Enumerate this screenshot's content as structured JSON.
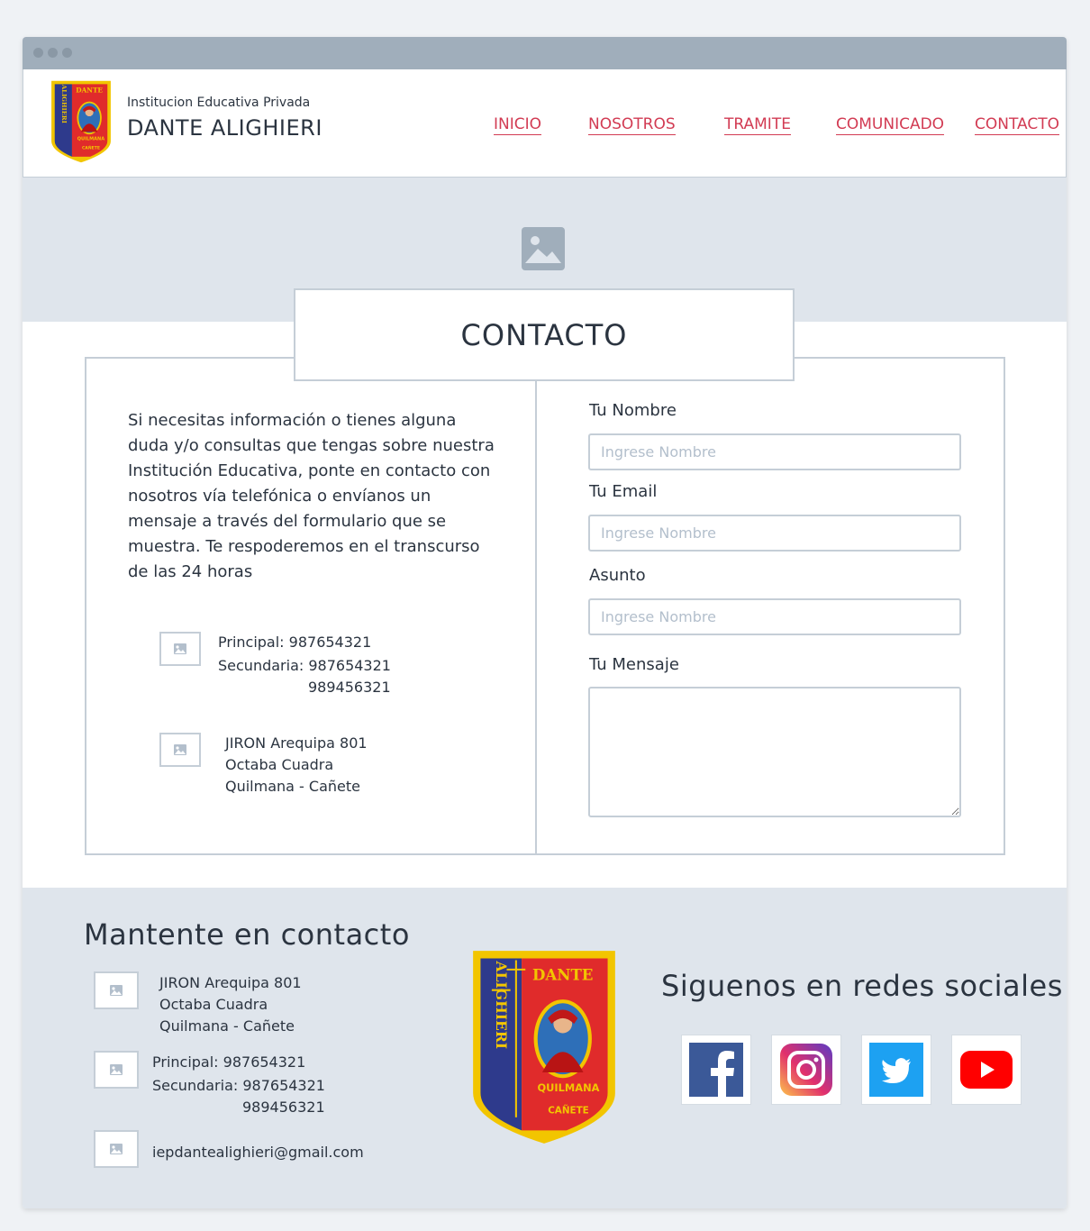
{
  "header": {
    "subtitle": "Institucion Educativa Privada",
    "title": "DANTE ALIGHIERI",
    "logo_text": {
      "top": "DANTE",
      "side": "ALIGHIERI",
      "bottom": "QUILMANA",
      "foot": "CAÑETE"
    }
  },
  "nav": {
    "items": [
      "INICIO",
      "NOSOTROS",
      "TRAMITE",
      "COMUNICADO",
      "CONTACTO"
    ]
  },
  "hero": {
    "image_icon": "image-placeholder-icon"
  },
  "contact": {
    "title": "CONTACTO",
    "intro": "Si necesitas información o tienes alguna duda y/o consultas que tengas sobre nuestra Institución Educativa, ponte en contacto con nosotros vía telefónica o envíanos un mensaje a través del formulario que se muestra. Te respoderemos en el transcurso de las 24 horas",
    "phones": {
      "principal": "Principal: 987654321",
      "secundaria": "Secundaria: 987654321",
      "secundaria2": "989456321"
    },
    "address": {
      "line1": "JIRON Arequipa 801",
      "line2": "Octaba Cuadra",
      "line3": "Quilmana - Cañete"
    }
  },
  "form": {
    "name_label": "Tu Nombre",
    "name_placeholder": "Ingrese Nombre",
    "email_label": "Tu Email",
    "email_placeholder": "Ingrese Nombre",
    "subject_label": "Asunto",
    "subject_placeholder": "Ingrese Nombre",
    "message_label": "Tu Mensaje"
  },
  "footer": {
    "title": "Mantente en contacto",
    "address": {
      "line1": "JIRON Arequipa 801",
      "line2": "Octaba Cuadra",
      "line3": "Quilmana - Cañete"
    },
    "phones": {
      "principal": "Principal: 987654321",
      "secundaria": "Secundaria: 987654321",
      "secundaria2": "989456321"
    },
    "email": "iepdantealighieri@gmail.com",
    "social_title": "Siguenos en redes sociales",
    "social_icons": [
      "facebook-icon",
      "instagram-icon",
      "twitter-icon",
      "youtube-icon"
    ]
  },
  "colors": {
    "accent": "#d23b53",
    "border": "#c5ced7",
    "hero_bg": "#dfe5ec",
    "chrome": "#a0aebb",
    "text": "#2b3440"
  }
}
